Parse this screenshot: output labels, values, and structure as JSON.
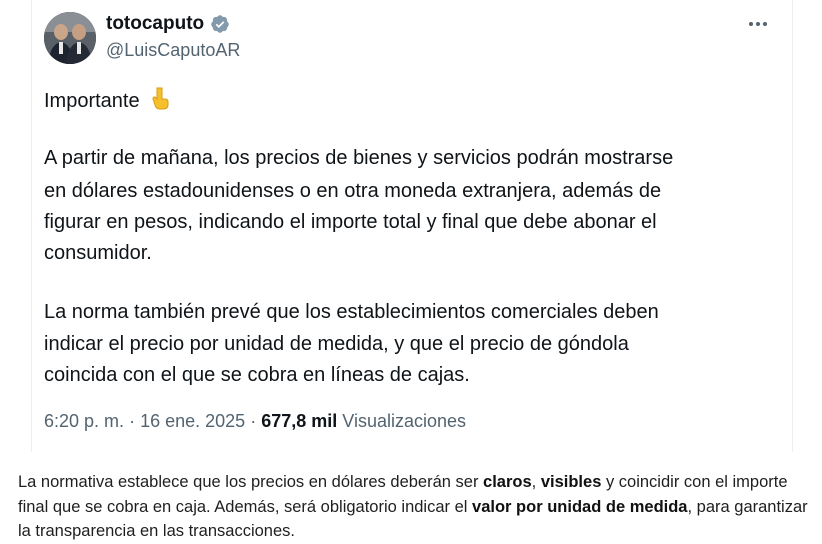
{
  "author": {
    "display_name": "totocaputo",
    "handle": "@LuisCaputoAR"
  },
  "tweet": {
    "lines": [
      "Importante",
      "A partir de mañana, los precios de bienes y servicios podrán mostrarse",
      "en dólares estadounidenses o en otra moneda extranjera, además de",
      "figurar en pesos, indicando el importe total y final que debe abonar el",
      "consumidor.",
      "La norma también prevé que los establecimientos comerciales deben",
      "indicar el precio por unidad de medida, y que el precio de góndola",
      "coincida con el que se cobra en líneas de cajas."
    ],
    "emoji": "point-down-icon"
  },
  "meta": {
    "time": "6:20 p. m.",
    "sep1": "·",
    "date": "16 ene. 2025",
    "sep2": "·",
    "views_count": "677,8 mil",
    "views_label": "Visualizaciones"
  },
  "caption": {
    "p1": "La normativa establece que los precios en dólares deberán ser ",
    "b1": "claros",
    "p2": ", ",
    "b2": "visibles",
    "p3": " y coincidir con el importe final que se cobra en caja. Además, será obligatorio indicar el ",
    "b3": "valor por unidad de medida",
    "p4": ", para garantizar la transparencia en las transacciones."
  },
  "colors": {
    "verified": "#829aab",
    "secondary_text": "#536471",
    "primary_text": "#0f1419"
  }
}
